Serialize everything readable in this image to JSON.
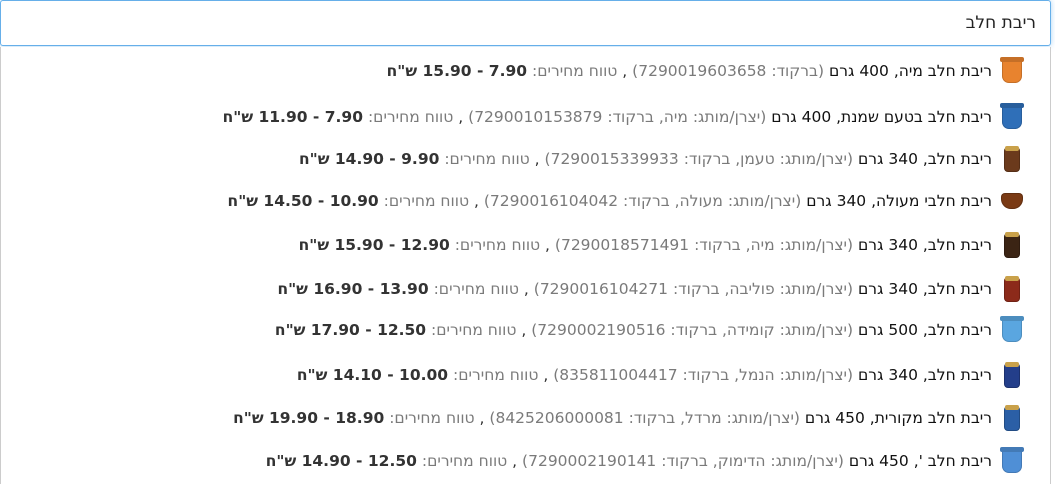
{
  "search": {
    "value": "ריבת חלב"
  },
  "results": [
    {
      "name": "ריבת חלב מיה, 400 גרם",
      "meta": "(ברקוד: 7290019603658)",
      "price_label": "טווח מחירים:",
      "price_range": "7.90 - 15.90 ש\"ח",
      "icon": "jam-cup-orange-icon",
      "thumb_color": "#e8832e",
      "thumb_style": "cup"
    },
    {
      "name": "ריבת חלב בטעם שמנת, 400 גרם",
      "meta": "(יצרן/מותג: מיה, ברקוד: 7290010153879)",
      "price_label": "טווח מחירים:",
      "price_range": "7.90 - 11.90 ש\"ח",
      "icon": "jam-cup-blue-icon",
      "thumb_color": "#2f6fb8",
      "thumb_style": "cup"
    },
    {
      "name": "ריבת חלב, 340 גרם",
      "meta": "(יצרן/מותג: טעמן, ברקוד: 7290015339933)",
      "price_label": "טווח מחירים:",
      "price_range": "9.90 - 14.90 ש\"ח",
      "icon": "jam-jar-brown-icon",
      "thumb_color": "#6b3a1c",
      "thumb_style": "jar"
    },
    {
      "name": "ריבת חלבי מעולה, 340 גרם",
      "meta": "(יצרן/מותג: מעולה, ברקוד: 7290016104042)",
      "price_label": "טווח מחירים:",
      "price_range": "10.90 - 14.50 ש\"ח",
      "icon": "jam-pot-brown-icon",
      "thumb_color": "#7a3a14",
      "thumb_style": "pot"
    },
    {
      "name": "ריבת חלב, 340 גרם",
      "meta": "(יצרן/מותג: מיה, ברקוד: 7290018571491)",
      "price_label": "טווח מחירים:",
      "price_range": "12.90 - 15.90 ש\"ח",
      "icon": "jam-jar-dark-icon",
      "thumb_color": "#3b2414",
      "thumb_style": "jar"
    },
    {
      "name": "ריבת חלב, 340 גרם",
      "meta": "(יצרן/מותג: פוליבה, ברקוד: 7290016104271)",
      "price_label": "טווח מחירים:",
      "price_range": "13.90 - 16.90 ש\"ח",
      "icon": "jam-jar-red-icon",
      "thumb_color": "#8c2a1a",
      "thumb_style": "jar"
    },
    {
      "name": "ריבת חלב, 500 גרם",
      "meta": "(יצרן/מותג: קומידה, ברקוד: 7290002190516)",
      "price_label": "טווח מחירים:",
      "price_range": "12.50 - 17.90 ש\"ח",
      "icon": "jam-cup-lightblue-icon",
      "thumb_color": "#5aa6e0",
      "thumb_style": "cup"
    },
    {
      "name": "ריבת חלב, 340 גרם",
      "meta": "(יצרן/מותג: הנמל, ברקוד: 835811004417)",
      "price_label": "טווח מחירים:",
      "price_range": "10.00 - 14.10 ש\"ח",
      "icon": "jam-jar-navy-icon",
      "thumb_color": "#233e8a",
      "thumb_style": "jar"
    },
    {
      "name": "ריבת חלב מקורית, 450 גרם",
      "meta": "(יצרן/מותג: מרדל, ברקוד: 8425206000081)",
      "price_label": "טווח מחירים:",
      "price_range": "18.90 - 19.90 ש\"ח",
      "icon": "jam-jar-blue-icon",
      "thumb_color": "#2b5fa6",
      "thumb_style": "jar"
    },
    {
      "name": "ריבת חלב ', 450 גרם",
      "meta": "(יצרן/מותג: הדימוק, ברקוד: 7290002190141)",
      "price_label": "טווח מחירים:",
      "price_range": "12.50 - 14.90 ש\"ח",
      "icon": "jam-cup-white-blue-icon",
      "thumb_color": "#4f8fd6",
      "thumb_style": "cup"
    }
  ]
}
